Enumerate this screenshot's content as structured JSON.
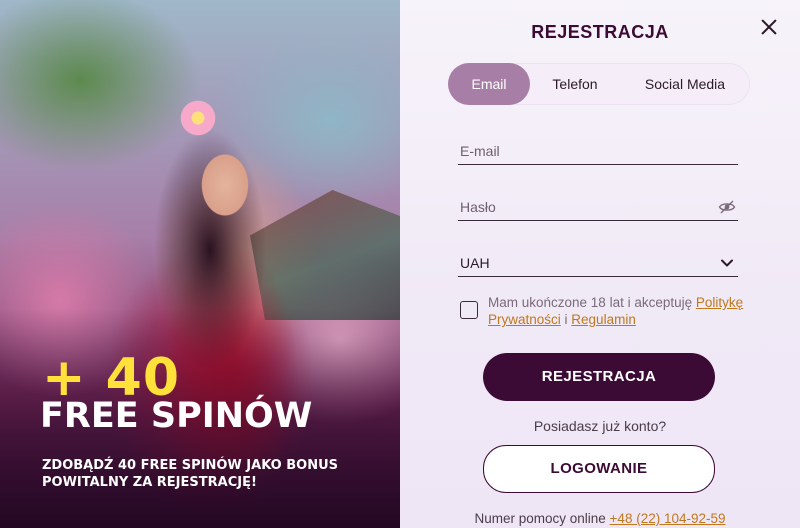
{
  "promo": {
    "bonus_amount": "+ 40",
    "bonus_label": "FREE SPINÓW",
    "description": "ZDOBĄDŹ 40 FREE SPINÓW JAKO BONUS POWITALNY ZA REJESTRACJĘ!"
  },
  "form": {
    "title": "REJESTRACJA",
    "close_icon": "close-icon",
    "tabs": [
      {
        "label": "Email",
        "active": true
      },
      {
        "label": "Telefon",
        "active": false
      },
      {
        "label": "Social Media",
        "active": false
      }
    ],
    "email": {
      "placeholder": "E-mail",
      "value": ""
    },
    "password": {
      "placeholder": "Hasło",
      "value": "",
      "icon": "eye-off-icon"
    },
    "currency": {
      "selected": "UAH",
      "icon": "chevron-down-icon"
    },
    "consent": {
      "checked": false,
      "text_before": "Mam ukończone 18 lat i akceptuję ",
      "privacy_link": "Politykę Prywatności",
      "separator": " i ",
      "terms_link": "Regulamin"
    },
    "submit_label": "REJESTRACJA",
    "have_account_text": "Posiadasz już konto?",
    "login_label": "LOGOWANIE",
    "help_text": "Numer pomocy online ",
    "help_phone": "+48 (22) 104-92-59"
  },
  "colors": {
    "brand_dark": "#3b0b35",
    "tab_active": "#a77fa6",
    "link": "#c0781e",
    "bonus_yellow": "#ffe13a"
  }
}
